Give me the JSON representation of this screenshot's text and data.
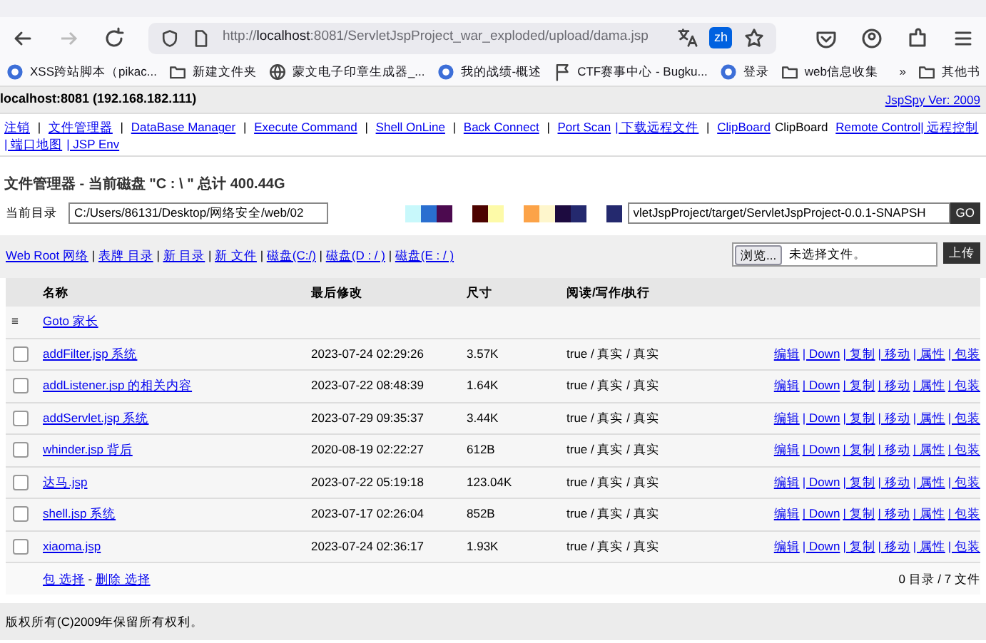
{
  "browser": {
    "url_prefix": "http://",
    "url_host": "localhost",
    "url_rest": ":8081/ServletJspProject_war_exploded/upload/dama.jsp",
    "translate_badge": "zh",
    "bookmarks": [
      {
        "kind": "site",
        "label": "XSS跨站脚本（pikac..."
      },
      {
        "kind": "folder",
        "label": "新建文件夹"
      },
      {
        "kind": "globe",
        "label": "蒙文电子印章生成器_..."
      },
      {
        "kind": "site",
        "label": "我的战绩-概述"
      },
      {
        "kind": "flag",
        "label": "CTF赛事中心 - Bugku..."
      },
      {
        "kind": "site",
        "label": "登录"
      },
      {
        "kind": "folder",
        "label": "web信息收集"
      }
    ],
    "overflow": "»",
    "other_bookmarks": "其他书"
  },
  "header": {
    "host": "localhost:8081 (192.168.182.111)",
    "version": "JspSpy Ver: 2009"
  },
  "nav": [
    {
      "text": "注销",
      "link": true
    },
    {
      "text": " | ",
      "link": false
    },
    {
      "text": "文件管理器",
      "link": true
    },
    {
      "text": " | ",
      "link": false
    },
    {
      "text": "DataBase Manager",
      "link": true
    },
    {
      "text": " | ",
      "link": false
    },
    {
      "text": "Execute Command",
      "link": true
    },
    {
      "text": " | ",
      "link": false
    },
    {
      "text": "Shell OnLine",
      "link": true
    },
    {
      "text": " | ",
      "link": false
    },
    {
      "text": "Back Connect",
      "link": true
    },
    {
      "text": " | ",
      "link": false
    },
    {
      "text": "Port Scan",
      "link": true
    },
    {
      "text": "| 下载远程文件",
      "link": true
    },
    {
      "text": " | ",
      "link": false
    },
    {
      "text": "ClipBoard",
      "link": true
    },
    {
      "text": "ClipBoard ",
      "link": false
    },
    {
      "text": "Remote Control| 远程控制",
      "link": true
    },
    {
      "text": "| 端口地图",
      "link": true
    },
    {
      "text": "| JSP Env",
      "link": true
    }
  ],
  "title": "文件管理器 - 当前磁盘 \"C : \\ \" 总计 400.44G",
  "path": {
    "label": "当前目录",
    "value_left": "C:/Users/86131/Desktop/网络安全/web/02",
    "value_right": "vletJspProject/target/ServletJspProject-0.0.1-SNAPSH",
    "button": "GO",
    "redaction_groups": [
      {
        "blocks": [
          {
            "color": "#c8f8fb"
          },
          {
            "color": "#2a6fd0"
          },
          {
            "color": "#4c0a4f"
          }
        ]
      },
      {
        "blocks": [
          {
            "color": "#4d0300"
          },
          {
            "color": "#fdfaa8"
          }
        ]
      },
      {
        "blocks": [
          {
            "color": "#fca348"
          },
          {
            "color": "#fef6cc"
          },
          {
            "color": "#1d0b40"
          },
          {
            "color": "#24296e"
          }
        ]
      },
      {
        "blocks": [
          {
            "color": "#24296e"
          }
        ]
      }
    ]
  },
  "toolbar": {
    "links": [
      {
        "text": "Web Root 网络",
        "link": true
      },
      {
        "text": " | ",
        "link": false
      },
      {
        "text": "表牌 目录",
        "link": true
      },
      {
        "text": " | ",
        "link": false
      },
      {
        "text": "新 目录",
        "link": true
      },
      {
        "text": " | ",
        "link": false
      },
      {
        "text": "新 文件",
        "link": true
      },
      {
        "text": " | ",
        "link": false
      },
      {
        "text": "磁盘(C:/)",
        "link": true
      },
      {
        "text": " | ",
        "link": false
      },
      {
        "text": "磁盘(D : / )",
        "link": true
      },
      {
        "text": " | ",
        "link": false
      },
      {
        "text": "磁盘(E : / )",
        "link": true
      }
    ],
    "browse_button": "浏览...",
    "file_status": "未选择文件。",
    "upload_button": "上传"
  },
  "table": {
    "columns": [
      "名称",
      "最后修改",
      "尺寸",
      "阅读/写作/执行"
    ],
    "parent": {
      "icon": "≡",
      "label": "Goto 家长"
    },
    "rows": [
      {
        "name": "addFilter.jsp 系统",
        "modified": "2023-07-24 02:29:26",
        "size": "3.57K",
        "perms": "true / 真实 / 真实",
        "checked": false,
        "actions": [
          "编辑",
          "| Down",
          "| 复制",
          "| 移动",
          "| 属性",
          "| 包装"
        ]
      },
      {
        "name": "addListener.jsp 的相关内容",
        "modified": "2023-07-22 08:48:39",
        "size": "1.64K",
        "perms": "true / 真实 / 真实",
        "checked": false,
        "actions": [
          "编辑",
          "| Down",
          "| 复制",
          "| 移动",
          "| 属性",
          "| 包装"
        ]
      },
      {
        "name": "addServlet.jsp 系统",
        "modified": "2023-07-29 09:35:37",
        "size": "3.44K",
        "perms": "true / 真实 / 真实",
        "checked": false,
        "actions": [
          "编辑",
          "| Down",
          "| 复制",
          "| 移动",
          "| 属性",
          "| 包装"
        ]
      },
      {
        "name": "whinder.jsp 背后",
        "modified": "2020-08-19 02:22:27",
        "size": "612B",
        "perms": "true / 真实 / 真实",
        "checked": false,
        "actions": [
          "编辑",
          "| Down",
          "| 复制",
          "| 移动",
          "| 属性",
          "| 包装"
        ]
      },
      {
        "name": "达马.jsp",
        "modified": "2023-07-22 05:19:18",
        "size": "123.04K",
        "perms": "true / 真实 / 真实",
        "checked": false,
        "actions": [
          "编辑",
          "| Down",
          "| 复制",
          "| 移动",
          "| 属性",
          "| 包装"
        ]
      },
      {
        "name": "shell.jsp 系统",
        "modified": "2023-07-17 02:26:04",
        "size": "852B",
        "perms": "true / 真实 / 真实",
        "checked": false,
        "actions": [
          "编辑",
          "| Down",
          "| 复制",
          "| 移动",
          "| 属性",
          "| 包装"
        ]
      },
      {
        "name": "xiaoma.jsp",
        "modified": "2023-07-24 02:36:17",
        "size": "1.93K",
        "perms": "true / 真实 / 真实",
        "checked": false,
        "actions": [
          "编辑",
          "| Down",
          "| 复制",
          "| 移动",
          "| 属性",
          "| 包装"
        ]
      }
    ],
    "footer_links": [
      {
        "text": "包 选择",
        "link": true
      },
      {
        "text": " - ",
        "link": false
      },
      {
        "text": "删除 选择",
        "link": true
      }
    ],
    "summary": "0 目录 / 7 文件"
  },
  "copyright": "版权所有(C)2009年保留所有权利。"
}
